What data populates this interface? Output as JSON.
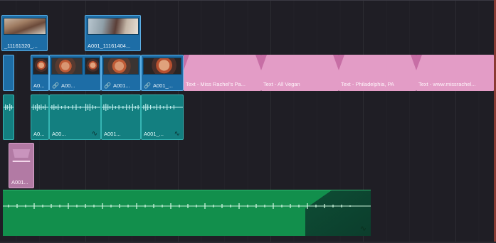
{
  "colors": {
    "background": "#1f1e25",
    "video_clip": "#1d6da6",
    "title_clip": "#e39cc6",
    "audio_clip": "#137f80",
    "music_clip": "#128f4c",
    "purple_clip": "#b27aa4"
  },
  "video_track_2": [
    {
      "label": "_11161320_..."
    },
    {
      "label": "A001_11161404..."
    }
  ],
  "video_track_1": [
    {
      "label": "A0..."
    },
    {
      "label": "A00..."
    },
    {
      "label": "A001..."
    },
    {
      "label": "A001_..."
    }
  ],
  "title_clips": [
    {
      "label": "Text - Miss Rachel's Pa..."
    },
    {
      "label": "Text - All Vegan"
    },
    {
      "label": "Text - Philadelphia, PA"
    },
    {
      "label": "Text - www.missrachel..."
    }
  ],
  "audio_track_1": [
    {
      "label": "A0..."
    },
    {
      "label": "A00..."
    },
    {
      "label": "A001..."
    },
    {
      "label": "A001_..."
    }
  ],
  "audio_track_2": [
    {
      "label": "A001..."
    }
  ],
  "icons": {
    "link": "link-icon",
    "volume_curve": "curve-icon"
  }
}
